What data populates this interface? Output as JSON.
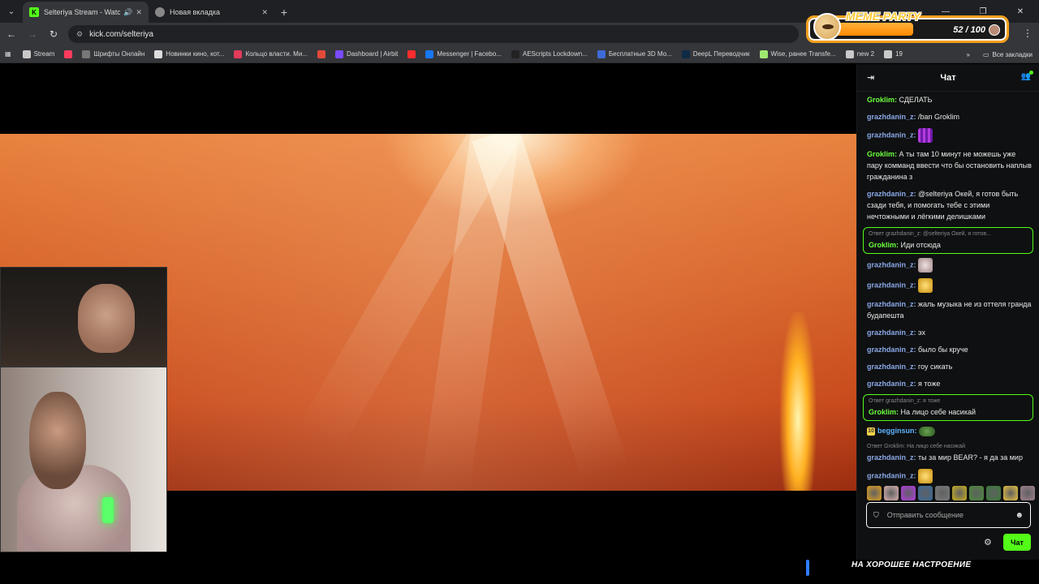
{
  "browser": {
    "tabs": [
      {
        "title": "Selteriya Stream - Watch Li",
        "active": true
      },
      {
        "title": "Новая вкладка",
        "active": false
      }
    ],
    "url": "kick.com/selteriya",
    "bookmarks": [
      {
        "label": "Stream",
        "color": "#c9c9c9"
      },
      {
        "label": "",
        "color": "#ff3b5c"
      },
      {
        "label": "Шрифты Онлайн",
        "color": "#777777"
      },
      {
        "label": "Новинки кино, кот...",
        "color": "#dddddd"
      },
      {
        "label": "Кольцо власти. Ми...",
        "color": "#e23a5a"
      },
      {
        "label": "",
        "color": "#e24a3a"
      },
      {
        "label": "Dashboard | Airbit",
        "color": "#7a4cff"
      },
      {
        "label": "",
        "color": "#ff2d2d"
      },
      {
        "label": "Messenger | Facebo...",
        "color": "#1877f2"
      },
      {
        "label": "AEScripts Lockdown...",
        "color": "#222222"
      },
      {
        "label": "Бесплатные 3D Мо...",
        "color": "#3d6cd8"
      },
      {
        "label": "DeepL Переводчик",
        "color": "#0f2b46"
      },
      {
        "label": "Wise, ранее Transfe...",
        "color": "#9fe870"
      },
      {
        "label": "new 2",
        "color": "#c9c9c9"
      },
      {
        "label": "19",
        "color": "#c9c9c9"
      }
    ],
    "bookmarks_more": "»",
    "all_bookmarks": "Все закладки"
  },
  "overlay": {
    "title": "MEME PARTY",
    "progress": "52 / 100",
    "progress_fraction": 0.52,
    "ticker": "НА ХОРОШЕЕ НАСТРОЕНИЕ"
  },
  "chat": {
    "title": "Чат",
    "messages": [
      {
        "user": "Groklim",
        "color": "green",
        "text": "СДЕЛАТЬ"
      },
      {
        "user": "grazhdanin_z",
        "color": "blue",
        "text": "/ban Groklim"
      },
      {
        "user": "grazhdanin_z",
        "color": "blue",
        "text": "",
        "emote": "grid"
      },
      {
        "user": "Groklim",
        "color": "green",
        "text": "А ты там 10 минут не можешь уже пару комманд ввести что бы остановить наплыв гражданина з"
      },
      {
        "user": "grazhdanin_z",
        "color": "blue",
        "text": "@selteriya Окей, я готов быть сзади тебя, и помогать тебе с этими нечтожными и лёгкими делишками"
      },
      {
        "user": "Groklim",
        "color": "green",
        "text": "Иди отсюда",
        "reply_to": "Ответ grazhdanin_z: @selteriya Окей, я готов..."
      },
      {
        "user": "grazhdanin_z",
        "color": "blue",
        "text": "",
        "emote": "cat"
      },
      {
        "user": "grazhdanin_z",
        "color": "blue",
        "text": "",
        "emote": "gold"
      },
      {
        "user": "grazhdanin_z",
        "color": "blue",
        "text": "жаль музыка не из оттеля гранда будапешта"
      },
      {
        "user": "grazhdanin_z",
        "color": "blue",
        "text": "эх"
      },
      {
        "user": "grazhdanin_z",
        "color": "blue",
        "text": "было бы круче"
      },
      {
        "user": "grazhdanin_z",
        "color": "blue",
        "text": "гоу сикать"
      },
      {
        "user": "grazhdanin_z",
        "color": "blue",
        "text": "я тоже"
      },
      {
        "user": "Groklim",
        "color": "green",
        "text": "На лицо себе насикай",
        "reply_to": "Ответ grazhdanin_z: я тоже"
      },
      {
        "user": "begginsun",
        "color": "sky",
        "text": "",
        "emote": "frog",
        "badge": "10"
      },
      {
        "user": "grazhdanin_z",
        "color": "blue",
        "text": "ты за мир BEAR? - я да за мир",
        "reply_to_plain": "Ответ Groklim: На лицо себе насикай"
      },
      {
        "user": "grazhdanin_z",
        "color": "blue",
        "text": "",
        "emote": "gold"
      }
    ],
    "emote_strip": [
      "#e0a020",
      "#d9b0b0",
      "#b23be0",
      "#3a6a9a",
      "#7a7a7a",
      "#c9b020",
      "#4a8a3a",
      "#3a7a3a",
      "#e8c040",
      "#a08090"
    ],
    "input_placeholder": "Отправить сообщение",
    "send_label": "Чат"
  }
}
